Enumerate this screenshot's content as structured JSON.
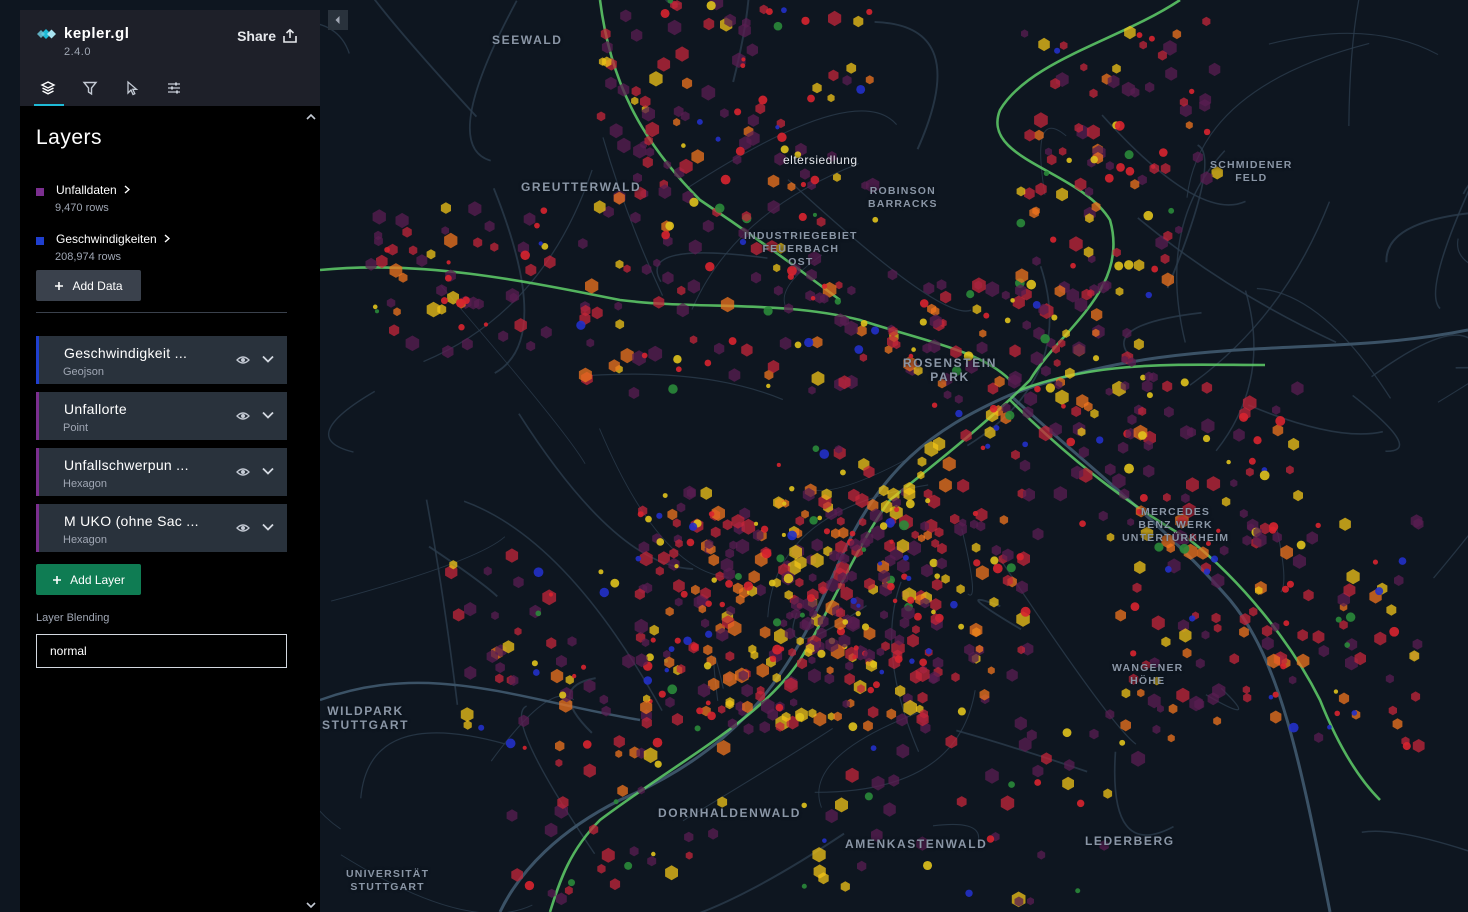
{
  "app": {
    "name": "kepler.gl",
    "version": "2.4.0",
    "share_label": "Share"
  },
  "nav_tabs": [
    {
      "icon": "layers-icon",
      "active": true
    },
    {
      "icon": "filter-icon",
      "active": false
    },
    {
      "icon": "interaction-pointer-icon",
      "active": false
    },
    {
      "icon": "map-settings-sliders-icon",
      "active": false
    }
  ],
  "panel": {
    "title": "Layers",
    "datasets": [
      {
        "name": "Unfalldaten",
        "rows": "9,470 rows",
        "color": "#7b2f8f"
      },
      {
        "name": "Geschwindigkeiten",
        "rows": "208,974 rows",
        "color": "#1f3fcf"
      }
    ],
    "add_data_label": "Add Data",
    "layers": [
      {
        "name": "Geschwindigkeit ...",
        "type": "Geojson",
        "color": "#1f3fcf"
      },
      {
        "name": "Unfallorte",
        "type": "Point",
        "color": "#7b2f8f"
      },
      {
        "name": "Unfallschwerpun ...",
        "type": "Hexagon",
        "color": "#7b2f8f"
      },
      {
        "name": "M UKO (ohne Sac ...",
        "type": "Hexagon",
        "color": "#7b2f8f"
      }
    ],
    "add_layer_label": "Add Layer",
    "layer_blending_label": "Layer Blending",
    "layer_blending_value": "normal"
  },
  "map": {
    "labels": [
      {
        "text": "SEEWALD"
      },
      {
        "text": "GREUTTERWALD"
      },
      {
        "text": "eltersiedlung"
      },
      {
        "text": "ROBINSON\nBARRACKS"
      },
      {
        "text": "SCHMIDENER\nFELD"
      },
      {
        "text": "INDUSTRIEGEBIET\nFEUERBACH\nOST"
      },
      {
        "text": "ROSENSTEIN\nPARK"
      },
      {
        "text": "MERCEDES\nBENZ WERK\nUNTERTÜRKHEIM"
      },
      {
        "text": "WANGENER\nHÖHE"
      },
      {
        "text": "WILDPARK\nSTUTTGART"
      },
      {
        "text": "DORNHALDENWALD"
      },
      {
        "text": "AMENKASTENWALD"
      },
      {
        "text": "LEDERBERG"
      },
      {
        "text": "UNIVERSITÄT\nSTUTTGART"
      }
    ],
    "colors": {
      "background": "#0e1620",
      "road": "#2c3c4c",
      "highway": "#3b5266",
      "speed_green": "#5fcf6a",
      "hex_purple": "#5a1d52",
      "hex_red": "#c4263a",
      "hex_orange": "#f0741e",
      "hex_yellow": "#f2c417"
    }
  }
}
